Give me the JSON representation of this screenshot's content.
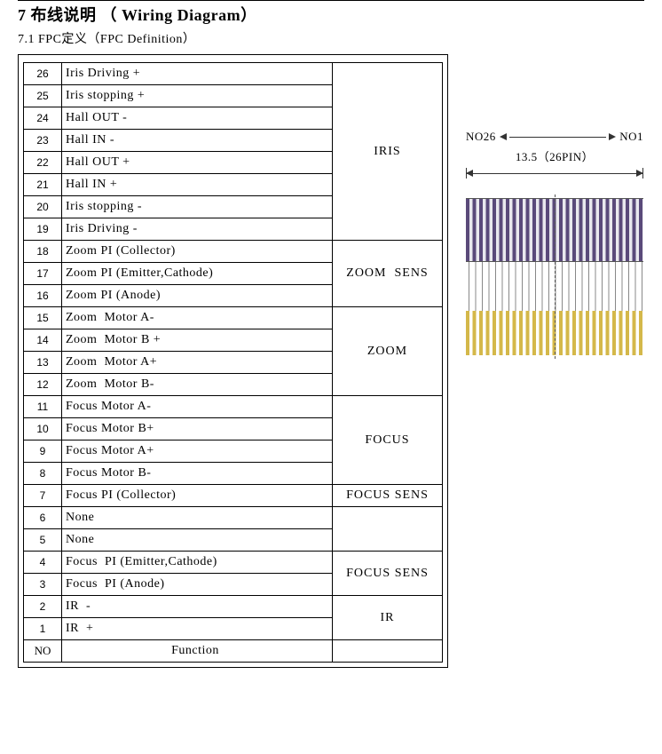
{
  "section": {
    "number": "7",
    "title_cn": "布线说明",
    "title_en": "Wiring Diagram",
    "sub_number": "7.1",
    "sub_title_cn": "FPC定义",
    "sub_title_en": "FPC  Definition"
  },
  "headers": {
    "no": "NO",
    "function": "Function"
  },
  "groups": {
    "iris": "IRIS",
    "zoom_sens": "ZOOM  SENS",
    "zoom": "ZOOM",
    "focus": "FOCUS",
    "focus_sens_1": "FOCUS SENS",
    "focus_sens_2": "FOCUS SENS",
    "ir": "IR"
  },
  "pins": {
    "p26": "Iris Driving +",
    "p25": "Iris stopping +",
    "p24": "Hall OUT -",
    "p23": "Hall IN -",
    "p22": "Hall OUT +",
    "p21": "Hall IN +",
    "p20": "Iris stopping -",
    "p19": "Iris Driving -",
    "p18": "Zoom PI (Collector)",
    "p17": "Zoom PI (Emitter,Cathode)",
    "p16": "Zoom PI (Anode)",
    "p15": "Zoom  Motor A-",
    "p14": "Zoom  Motor B +",
    "p13": "Zoom  Motor A+",
    "p12": "Zoom  Motor B-",
    "p11": "Focus Motor A-",
    "p10": "Focus Motor B+",
    "p9": "Focus Motor A+",
    "p8": "Focus Motor B-",
    "p7": "Focus PI (Collector)",
    "p6": "None",
    "p5": "None",
    "p4": "Focus  PI (Emitter,Cathode)",
    "p3": "Focus  PI (Anode)",
    "p2": "IR  -",
    "p1": "IR  +"
  },
  "nums": {
    "n26": "26",
    "n25": "25",
    "n24": "24",
    "n23": "23",
    "n22": "22",
    "n21": "21",
    "n20": "20",
    "n19": "19",
    "n18": "18",
    "n17": "17",
    "n16": "16",
    "n15": "15",
    "n14": "14",
    "n13": "13",
    "n12": "12",
    "n11": "11",
    "n10": "10",
    "n9": "9",
    "n8": "8",
    "n7": "7",
    "n6": "6",
    "n5": "5",
    "n4": "4",
    "n3": "3",
    "n2": "2",
    "n1": "1"
  },
  "connector": {
    "left_label": "NO26",
    "right_label": "NO1",
    "dimension": "13.5（26PIN）"
  }
}
